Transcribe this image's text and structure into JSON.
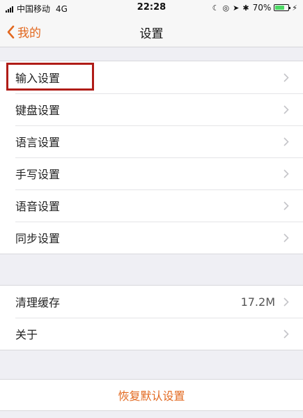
{
  "status_bar": {
    "carrier": "中国移动",
    "network": "4G",
    "time": "22:28",
    "battery_percent": "70%",
    "battery_level": 0.7,
    "icons": [
      "moon-icon",
      "orientation-lock-icon",
      "location-icon",
      "bluetooth-icon",
      "battery-icon",
      "charging-icon"
    ]
  },
  "nav": {
    "back_label": "我的",
    "title": "设置"
  },
  "section1": {
    "items": [
      {
        "label": "输入设置"
      },
      {
        "label": "键盘设置"
      },
      {
        "label": "语言设置"
      },
      {
        "label": "手写设置"
      },
      {
        "label": "语音设置"
      },
      {
        "label": "同步设置"
      }
    ]
  },
  "section2": {
    "items": [
      {
        "label": "清理缓存",
        "value": "17.2M"
      },
      {
        "label": "关于"
      }
    ]
  },
  "reset": {
    "label": "恢复默认设置"
  },
  "colors": {
    "accent": "#e2681f",
    "highlight_border": "#b01c17",
    "background": "#efeff4"
  }
}
